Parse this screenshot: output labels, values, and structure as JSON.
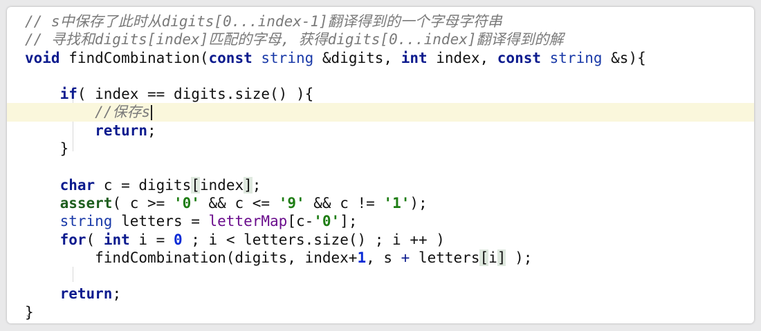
{
  "editor": {
    "lines": [
      {
        "segments": [
          {
            "t": "c",
            "v": "// s中保存了此时从digits[0...index-1]翻译得到的一个字母字符串"
          }
        ]
      },
      {
        "segments": [
          {
            "t": "c",
            "v": "// 寻找和digits[index]匹配的字母, 获得digits[0...index]翻译得到的解"
          }
        ]
      },
      {
        "segments": [
          {
            "t": "kw",
            "v": "void"
          },
          {
            "t": "p",
            "v": " findCombination("
          },
          {
            "t": "kw",
            "v": "const"
          },
          {
            "t": "p",
            "v": " "
          },
          {
            "t": "ty",
            "v": "string"
          },
          {
            "t": "p",
            "v": " &digits, "
          },
          {
            "t": "kw",
            "v": "int"
          },
          {
            "t": "p",
            "v": " index, "
          },
          {
            "t": "kw",
            "v": "const"
          },
          {
            "t": "p",
            "v": " "
          },
          {
            "t": "ty",
            "v": "string"
          },
          {
            "t": "p",
            "v": " &s){"
          }
        ]
      },
      {
        "segments": []
      },
      {
        "segments": [
          {
            "t": "p",
            "v": "    "
          },
          {
            "t": "kw",
            "v": "if"
          },
          {
            "t": "p",
            "v": "( index == digits.size() ){"
          }
        ]
      },
      {
        "segments": [
          {
            "t": "p",
            "v": "        "
          },
          {
            "t": "c",
            "v": "//保存s"
          }
        ],
        "highlight": true,
        "caret": true
      },
      {
        "segments": [
          {
            "t": "p",
            "v": "        "
          },
          {
            "t": "kw",
            "v": "return"
          },
          {
            "t": "p",
            "v": ";"
          }
        ]
      },
      {
        "segments": [
          {
            "t": "p",
            "v": "    }"
          }
        ]
      },
      {
        "segments": []
      },
      {
        "segments": [
          {
            "t": "p",
            "v": "    "
          },
          {
            "t": "kw",
            "v": "char"
          },
          {
            "t": "p",
            "v": " c = digits"
          },
          {
            "t": "br",
            "v": "["
          },
          {
            "t": "p",
            "v": "index"
          },
          {
            "t": "br",
            "v": "]"
          },
          {
            "t": "p",
            "v": ";"
          }
        ]
      },
      {
        "segments": [
          {
            "t": "p",
            "v": "    "
          },
          {
            "t": "fnc",
            "v": "assert"
          },
          {
            "t": "p",
            "v": "( c >= "
          },
          {
            "t": "str",
            "v": "'0'"
          },
          {
            "t": "p",
            "v": " && c <= "
          },
          {
            "t": "str",
            "v": "'9'"
          },
          {
            "t": "p",
            "v": " && c != "
          },
          {
            "t": "str",
            "v": "'1'"
          },
          {
            "t": "p",
            "v": ");"
          }
        ]
      },
      {
        "segments": [
          {
            "t": "p",
            "v": "    "
          },
          {
            "t": "ty",
            "v": "string"
          },
          {
            "t": "p",
            "v": " letters = "
          },
          {
            "t": "mem",
            "v": "letterMap"
          },
          {
            "t": "p",
            "v": "[c-"
          },
          {
            "t": "str",
            "v": "'0'"
          },
          {
            "t": "p",
            "v": "];"
          }
        ]
      },
      {
        "segments": [
          {
            "t": "p",
            "v": "    "
          },
          {
            "t": "kw",
            "v": "for"
          },
          {
            "t": "p",
            "v": "( "
          },
          {
            "t": "kw",
            "v": "int"
          },
          {
            "t": "p",
            "v": " i = "
          },
          {
            "t": "num",
            "v": "0"
          },
          {
            "t": "p",
            "v": " ; i < letters.size() ; i ++ )"
          }
        ]
      },
      {
        "segments": [
          {
            "t": "p",
            "v": "        findCombination(digits, index+"
          },
          {
            "t": "num",
            "v": "1"
          },
          {
            "t": "p",
            "v": ", s "
          },
          {
            "t": "op",
            "v": "+"
          },
          {
            "t": "p",
            "v": " letters"
          },
          {
            "t": "br",
            "v": "["
          },
          {
            "t": "p",
            "v": "i"
          },
          {
            "t": "br",
            "v": "]"
          },
          {
            "t": "p",
            "v": " );"
          }
        ]
      },
      {
        "segments": []
      },
      {
        "segments": [
          {
            "t": "p",
            "v": "    "
          },
          {
            "t": "kw",
            "v": "return"
          },
          {
            "t": "p",
            "v": ";"
          }
        ]
      },
      {
        "segments": [
          {
            "t": "p",
            "v": "}"
          }
        ]
      }
    ]
  }
}
